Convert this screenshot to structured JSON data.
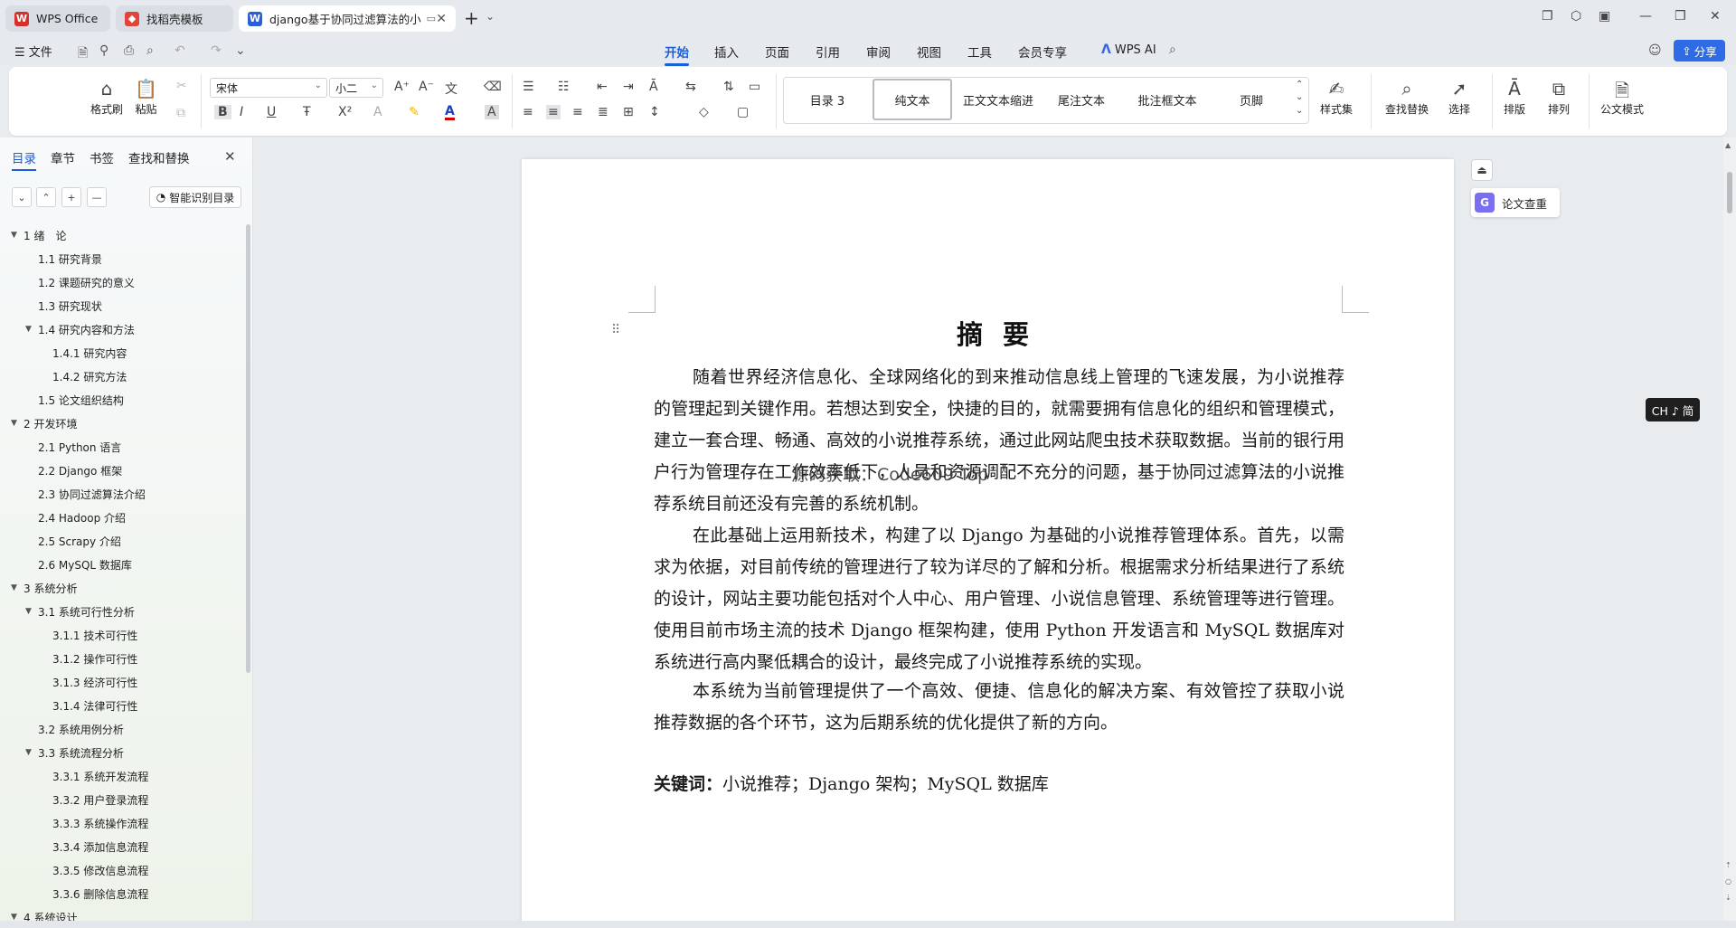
{
  "tabs": [
    {
      "label": "WPS Office",
      "icon": "wps-logo-icon",
      "color": "#d4312c"
    },
    {
      "label": "找稻壳模板",
      "icon": "docer-logo-icon",
      "color": "#e3443a"
    },
    {
      "label": "django基于协同过滤算法的小",
      "icon": "word-doc-icon",
      "color": "#2b5fd9"
    }
  ],
  "menu": {
    "file": "文件",
    "tabs": [
      "开始",
      "插入",
      "页面",
      "引用",
      "审阅",
      "视图",
      "工具",
      "会员专享"
    ],
    "wps_ai": "WPS AI",
    "share": "分享"
  },
  "ribbon": {
    "format_painter": "格式刷",
    "paste": "粘贴",
    "font": "宋体",
    "size": "小二",
    "styles": [
      "目录 3",
      "纯文本",
      "正文文本缩进",
      "尾注文本",
      "批注框文本",
      "页脚"
    ],
    "style_set": "样式集",
    "find_replace": "查找替换",
    "select": "选择",
    "layout": "排版",
    "arrange": "排列",
    "official": "公文模式"
  },
  "nav": {
    "tabs": [
      "目录",
      "章节",
      "书签",
      "查找和替换"
    ],
    "smart_toc": "智能识别目录",
    "items": [
      {
        "text": "1 绪　论",
        "level": 0,
        "caret": true
      },
      {
        "text": "1.1 研究背景",
        "level": 1,
        "caret": false
      },
      {
        "text": "1.2 课题研究的意义",
        "level": 1,
        "caret": false
      },
      {
        "text": "1.3 研究现状",
        "level": 1,
        "caret": false
      },
      {
        "text": "1.4 研究内容和方法",
        "level": 1,
        "caret": true
      },
      {
        "text": "1.4.1 研究内容",
        "level": 2,
        "caret": false
      },
      {
        "text": "1.4.2 研究方法",
        "level": 2,
        "caret": false
      },
      {
        "text": "1.5 论文组织结构",
        "level": 1,
        "caret": false
      },
      {
        "text": "2 开发环境",
        "level": 0,
        "caret": true
      },
      {
        "text": "2.1 Python 语言",
        "level": 1,
        "caret": false
      },
      {
        "text": "2.2 Django 框架",
        "level": 1,
        "caret": false
      },
      {
        "text": "2.3 协同过滤算法介绍",
        "level": 1,
        "caret": false
      },
      {
        "text": "2.4 Hadoop 介绍",
        "level": 1,
        "caret": false
      },
      {
        "text": "2.5 Scrapy 介绍",
        "level": 1,
        "caret": false
      },
      {
        "text": "2.6 MySQL 数据库",
        "level": 1,
        "caret": false
      },
      {
        "text": "3 系统分析",
        "level": 0,
        "caret": true
      },
      {
        "text": "3.1  系统可行性分析",
        "level": 1,
        "caret": true
      },
      {
        "text": "3.1.1  技术可行性",
        "level": 2,
        "caret": false
      },
      {
        "text": "3.1.2  操作可行性",
        "level": 2,
        "caret": false
      },
      {
        "text": "3.1.3  经济可行性",
        "level": 2,
        "caret": false
      },
      {
        "text": "3.1.4  法律可行性",
        "level": 2,
        "caret": false
      },
      {
        "text": "3.2  系统用例分析",
        "level": 1,
        "caret": false
      },
      {
        "text": "3.3 系统流程分析",
        "level": 1,
        "caret": true
      },
      {
        "text": "3.3.1  系统开发流程",
        "level": 2,
        "caret": false
      },
      {
        "text": "3.3.2  用户登录流程",
        "level": 2,
        "caret": false
      },
      {
        "text": "3.3.3  系统操作流程",
        "level": 2,
        "caret": false
      },
      {
        "text": "3.3.4  添加信息流程",
        "level": 2,
        "caret": false
      },
      {
        "text": "3.3.5  修改信息流程",
        "level": 2,
        "caret": false
      },
      {
        "text": "3.3.6  删除信息流程",
        "level": 2,
        "caret": false
      },
      {
        "text": "4  系统设计",
        "level": 0,
        "caret": true
      }
    ]
  },
  "document": {
    "title": "摘要",
    "paragraphs": [
      "随着世界经济信息化、全球网络化的到来推动信息线上管理的飞速发展，为小说推荐的管理起到关键作用。若想达到安全，快捷的目的，就需要拥有信息化的组织和管理模式，建立一套合理、畅通、高效的小说推荐系统，通过此网站爬虫技术获取数据。当前的银行用户行为管理存在工作效率低下，人员和资源调配不充分的问题，基于协同过滤算法的小说推荐系统目前还没有完善的系统机制。",
      "在此基础上运用新技术，构建了以 Django 为基础的小说推荐管理体系。首先，以需求为依据，对目前传统的管理进行了较为详尽的了解和分析。根据需求分析结果进行了系统的设计，网站主要功能包括对个人中心、用户管理、小说信息管理、系统管理等进行管理。使用目前市场主流的技术 Django 框架构建，使用 Python 开发语言和 MySQL 数据库对系统进行高内聚低耦合的设计，最终完成了小说推荐系统的实现。",
      "本系统为当前管理提供了一个高效、便捷、信息化的解决方案、有效管控了获取小说推荐数据的各个环节，这为后期系统的优化提供了新的方向。"
    ],
    "keywords_label": "关键词：",
    "keywords": "小说推荐；Django 架构；MySQL 数据库",
    "watermark": "源码获取：Code609 Top"
  },
  "side": {
    "plagiarism": "论文查重",
    "ime": "CH ♪ 简"
  }
}
